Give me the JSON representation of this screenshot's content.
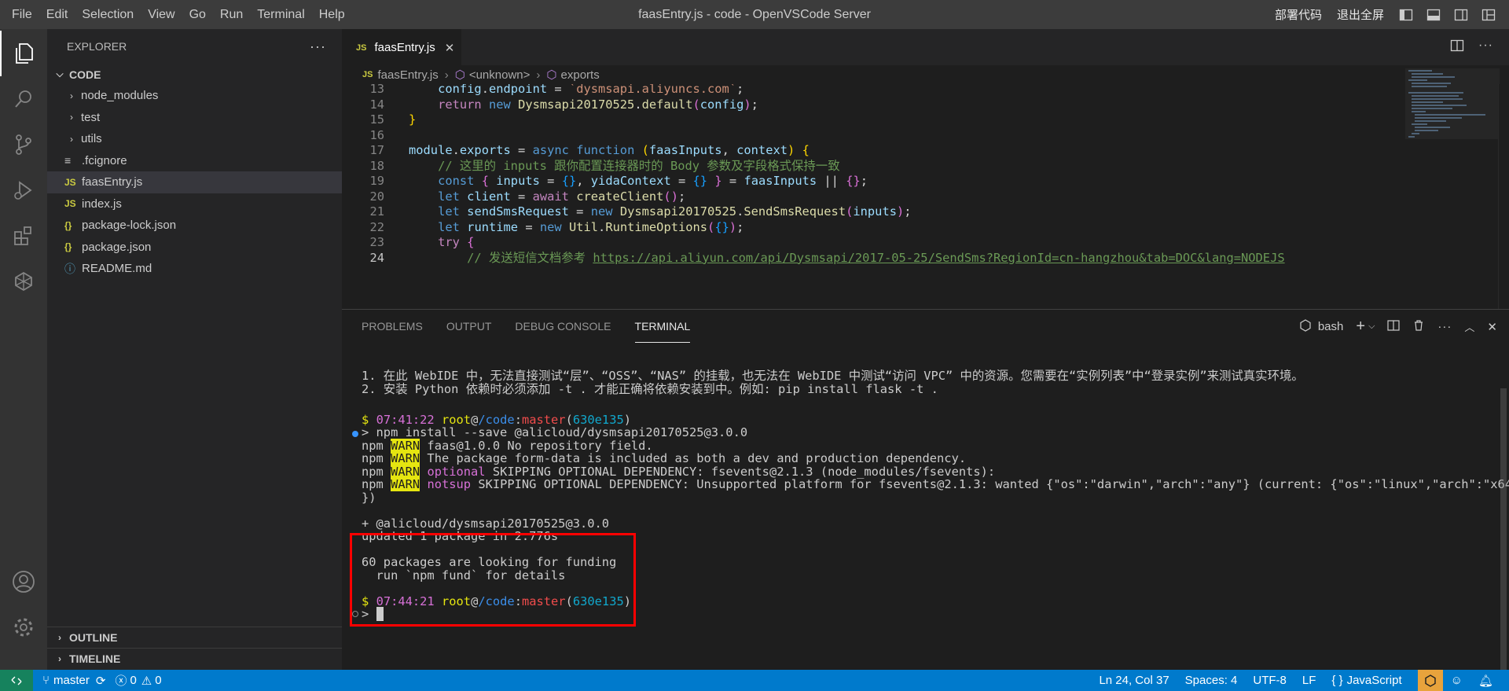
{
  "window_title": "faasEntry.js - code - OpenVSCode Server",
  "menu": [
    "File",
    "Edit",
    "Selection",
    "View",
    "Go",
    "Run",
    "Terminal",
    "Help"
  ],
  "title_right": {
    "deploy": "部署代码",
    "exit_fullscreen": "退出全屏"
  },
  "explorer": {
    "header": "EXPLORER",
    "section": "CODE",
    "items": [
      {
        "label": "node_modules",
        "type": "folder"
      },
      {
        "label": "test",
        "type": "folder"
      },
      {
        "label": "utils",
        "type": "folder"
      },
      {
        "label": ".fcignore",
        "type": "file",
        "icon": "≡"
      },
      {
        "label": "faasEntry.js",
        "type": "file",
        "icon": "JS",
        "selected": true
      },
      {
        "label": "index.js",
        "type": "file",
        "icon": "JS"
      },
      {
        "label": "package-lock.json",
        "type": "file",
        "icon": "{}"
      },
      {
        "label": "package.json",
        "type": "file",
        "icon": "{}"
      },
      {
        "label": "README.md",
        "type": "file",
        "icon": "ⓘ"
      }
    ],
    "outline": "OUTLINE",
    "timeline": "TIMELINE"
  },
  "tab": {
    "badge": "JS",
    "label": "faasEntry.js",
    "close": "✕"
  },
  "breadcrumb": {
    "file": "faasEntry.js",
    "badge": "JS",
    "part2": "<unknown>",
    "part3": "exports"
  },
  "code": {
    "lines": [
      {
        "n": "13",
        "html": "    <span class='id'>config</span><span class='pl'>.</span><span class='id'>endpoint</span><span class='pl'> = </span><span class='str'>`dysmsapi.aliyuncs.com`</span><span class='pl'>;</span>"
      },
      {
        "n": "14",
        "html": "    <span class='kwc'>return</span><span class='pl'> </span><span class='kw'>new</span><span class='pl'> </span><span class='cls'>Dysmsapi20170525</span><span class='pl'>.</span><span class='fn'>default</span><span class='br2'>(</span><span class='id'>config</span><span class='br2'>)</span><span class='pl'>;</span>"
      },
      {
        "n": "15",
        "html": "<span class='br1'>}</span>"
      },
      {
        "n": "16",
        "html": ""
      },
      {
        "n": "17",
        "html": "<span class='id'>module</span><span class='pl'>.</span><span class='id'>exports</span><span class='pl'> = </span><span class='kw'>async</span><span class='pl'> </span><span class='kw'>function</span><span class='pl'> </span><span class='br1'>(</span><span class='id'>faasInputs</span><span class='pl'>, </span><span class='id'>context</span><span class='br1'>)</span><span class='pl'> </span><span class='br1'>{</span>"
      },
      {
        "n": "18",
        "html": "    <span class='cmt'>// 这里的 inputs 跟你配置连接器时的 Body 参数及字段格式保持一致</span>"
      },
      {
        "n": "19",
        "html": "    <span class='kw'>const</span><span class='pl'> </span><span class='br2'>{</span><span class='pl'> </span><span class='id'>inputs</span><span class='pl'> = </span><span class='br3'>{}</span><span class='pl'>, </span><span class='id'>yidaContext</span><span class='pl'> = </span><span class='br3'>{}</span><span class='pl'> </span><span class='br2'>}</span><span class='pl'> = </span><span class='id'>faasInputs</span><span class='pl'> || </span><span class='br2'>{}</span><span class='pl'>;</span>"
      },
      {
        "n": "20",
        "html": "    <span class='kw'>let</span><span class='pl'> </span><span class='id'>client</span><span class='pl'> = </span><span class='kwc'>await</span><span class='pl'> </span><span class='fn'>createClient</span><span class='br2'>()</span><span class='pl'>;</span>"
      },
      {
        "n": "21",
        "html": "    <span class='kw'>let</span><span class='pl'> </span><span class='id'>sendSmsRequest</span><span class='pl'> = </span><span class='kw'>new</span><span class='pl'> </span><span class='cls'>Dysmsapi20170525</span><span class='pl'>.</span><span class='cls'>SendSmsRequest</span><span class='br2'>(</span><span class='id'>inputs</span><span class='br2'>)</span><span class='pl'>;</span>"
      },
      {
        "n": "22",
        "html": "    <span class='kw'>let</span><span class='pl'> </span><span class='id'>runtime</span><span class='pl'> = </span><span class='kw'>new</span><span class='pl'> </span><span class='cls'>Util</span><span class='pl'>.</span><span class='cls'>RuntimeOptions</span><span class='br2'>(</span><span class='br3'>{}</span><span class='br2'>)</span><span class='pl'>;</span>"
      },
      {
        "n": "23",
        "html": "    <span class='kwc'>try</span><span class='pl'> </span><span class='br2'>{</span>"
      },
      {
        "n": "24",
        "html": "        <span class='cmt'>// 发送短信文档参考 <span class='url'>https://api.aliyun.com/api/Dysmsapi/2017-05-25/SendSms?RegionId=cn-hangzhou&amp;tab=DOC&amp;lang=NODEJS</span></span>"
      }
    ]
  },
  "panel": {
    "tabs": [
      "PROBLEMS",
      "OUTPUT",
      "DEBUG CONSOLE",
      "TERMINAL"
    ],
    "active_tab": "TERMINAL",
    "shell": "bash"
  },
  "terminal": [
    {
      "html": "1. 在此 WebIDE 中，无法直接测试“层”、“OSS”、“NAS” 的挂载，也无法在 WebIDE 中测试“访问 VPC” 中的资源。您需要在“实例列表”中“登录实例”来测试真实环境。"
    },
    {
      "html": "2. 安装 Python 依赖时必须添加 -t . 才能正确将依赖安装到中。例如: pip install flask -t ."
    },
    {
      "html": ""
    },
    {
      "html": "<span class='yel'>$</span> <span class='mag'>07:41:22</span> <span class='yel'>root</span>@<span class='blue'>/code</span>:<span class='red'>master</span>(<span class='cyan'>630e135</span>)"
    },
    {
      "html": "&gt; npm install --save @alicloud/dysmsapi20170525@3.0.0"
    },
    {
      "html": "npm <span class='warn'>WARN</span> faas@1.0.0 No repository field."
    },
    {
      "html": "npm <span class='warn'>WARN</span> The package form-data is included as both a dev and production dependency."
    },
    {
      "html": "npm <span class='warn'>WARN</span> <span class='mag'>optional</span> SKIPPING OPTIONAL DEPENDENCY: fsevents@2.1.3 (node_modules/fsevents):"
    },
    {
      "html": "npm <span class='warn'>WARN</span> <span class='mag'>notsup</span> SKIPPING OPTIONAL DEPENDENCY: Unsupported platform for fsevents@2.1.3: wanted {\"os\":\"darwin\",\"arch\":\"any\"} (current: {\"os\":\"linux\",\"arch\":\"x64\""
    },
    {
      "html": "})"
    },
    {
      "html": ""
    },
    {
      "html": "+ @alicloud/dysmsapi20170525@3.0.0"
    },
    {
      "html": "updated 1 package in 2.776s"
    },
    {
      "html": ""
    },
    {
      "html": "60 packages are looking for funding"
    },
    {
      "html": "  run `npm fund` for details"
    },
    {
      "html": ""
    },
    {
      "html": "<span class='yel'>$</span> <span class='mag'>07:44:21</span> <span class='yel'>root</span>@<span class='blue'>/code</span>:<span class='red'>master</span>(<span class='cyan'>630e135</span>)"
    },
    {
      "html": "&gt; <span style='background:#cccccc;color:#1e1e1e'> </span>"
    }
  ],
  "status": {
    "branch": "master",
    "errors": "0",
    "warnings": "0",
    "position": "Ln 24, Col 37",
    "spaces": "Spaces: 4",
    "encoding": "UTF-8",
    "eol": "LF",
    "language": "JavaScript"
  },
  "colors": {
    "accent": "#007acc",
    "remote": "#16825d",
    "highlight_box": "#ff0000"
  }
}
